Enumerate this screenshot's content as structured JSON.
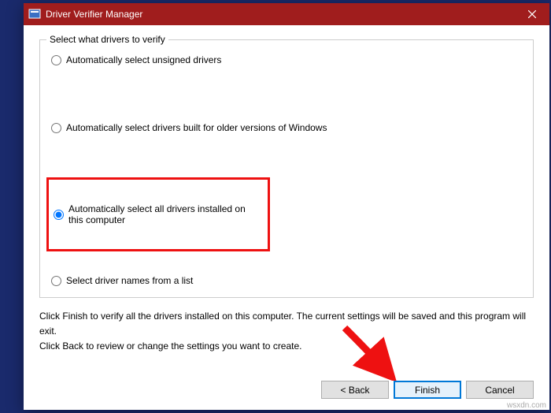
{
  "titlebar": {
    "title": "Driver Verifier Manager"
  },
  "groupbox": {
    "legend": "Select what drivers to verify",
    "options": {
      "opt1": "Automatically select unsigned drivers",
      "opt2": "Automatically select drivers built for older versions of Windows",
      "opt3": "Automatically select all drivers installed on this computer",
      "opt4": "Select driver names from a list"
    }
  },
  "instructions": {
    "line1": "Click Finish to verify all the drivers installed on this computer. The current settings will be saved and this program will exit.",
    "line2": "Click Back to review or change the settings you want to create."
  },
  "buttons": {
    "back": "< Back",
    "finish": "Finish",
    "cancel": "Cancel"
  },
  "watermark": "wsxdn.com"
}
